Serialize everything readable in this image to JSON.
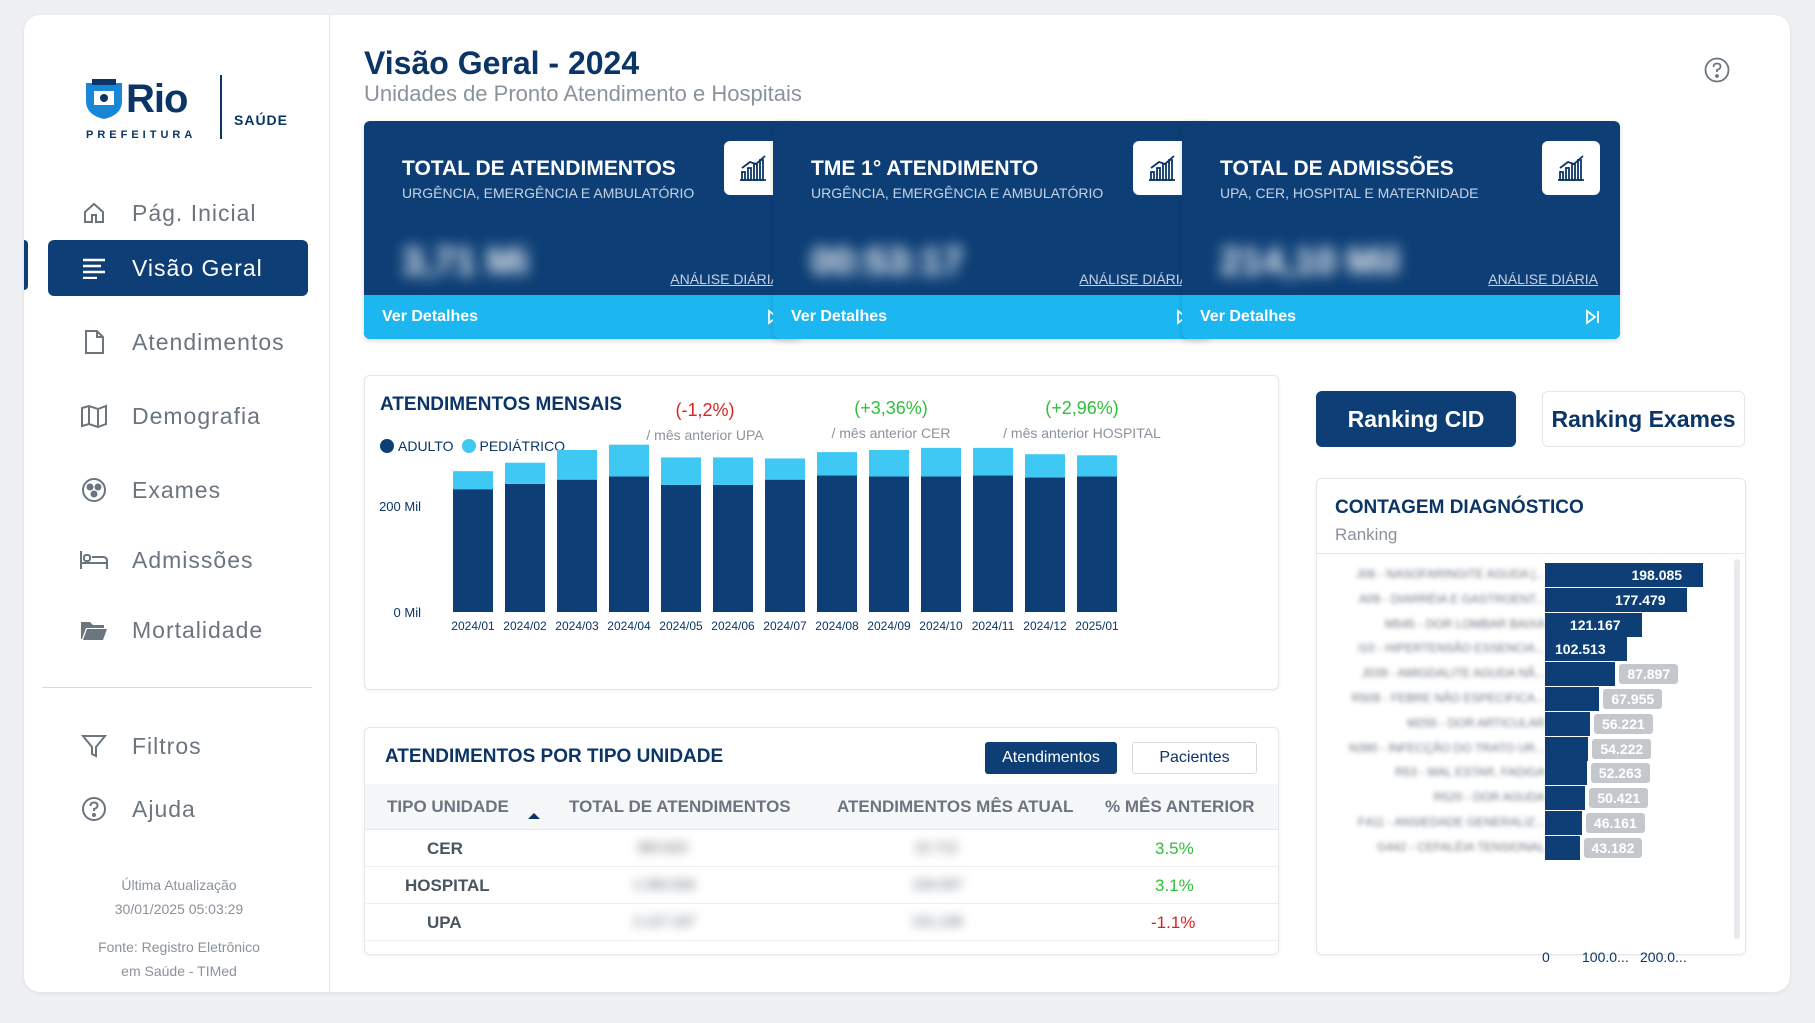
{
  "brand": {
    "name": "Rio",
    "sub": "PREFEITURA",
    "dept": "SAÚDE"
  },
  "sidebar": {
    "items": [
      {
        "label": "Pág. Inicial",
        "icon": "home-icon"
      },
      {
        "label": "Visão Geral",
        "icon": "list-icon"
      },
      {
        "label": "Atendimentos",
        "icon": "document-icon"
      },
      {
        "label": "Demografia",
        "icon": "map-icon"
      },
      {
        "label": "Exames",
        "icon": "dots-circle-icon"
      },
      {
        "label": "Admissões",
        "icon": "bed-icon"
      },
      {
        "label": "Mortalidade",
        "icon": "folder-icon"
      },
      {
        "label": "Filtros",
        "icon": "filter-icon"
      },
      {
        "label": "Ajuda",
        "icon": "help-icon"
      }
    ],
    "update_label": "Última Atualização",
    "update_time": "30/01/2025 05:03:29",
    "source_line1": "Fonte: Registro Eletrônico",
    "source_line2": "em Saúde - TIMed"
  },
  "header": {
    "title": "Visão Geral - 2024",
    "subtitle": "Unidades de Pronto Atendimento e Hospitais"
  },
  "kpis": [
    {
      "title": "TOTAL DE ATENDIMENTOS",
      "sub": "URGÊNCIA, EMERGÊNCIA E AMBULATÓRIO",
      "value": "3,71 Mi",
      "link": "ANÁLISE DIÁRIA",
      "footer": "Ver Detalhes"
    },
    {
      "title": "TME 1° ATENDIMENTO",
      "sub": "URGÊNCIA, EMERGÊNCIA E AMBULATÓRIO",
      "value": "00:53:17",
      "link": "ANÁLISE DIÁRIA",
      "footer": "Ver Detalhes"
    },
    {
      "title": "TOTAL DE ADMISSÕES",
      "sub": "UPA, CER, HOSPITAL E MATERNIDADE",
      "value": "214,10 Mil",
      "link": "ANÁLISE DIÁRIA",
      "footer": "Ver Detalhes"
    }
  ],
  "monthly": {
    "title": "ATENDIMENTOS MENSAIS",
    "legend": [
      "ADULTO",
      "PEDIÁTRICO"
    ],
    "comparisons": [
      {
        "pct": "(-1,2%)",
        "label": "/ mês anterior UPA",
        "color": "#e02020"
      },
      {
        "pct": "(+3,36%)",
        "label": "/ mês anterior CER",
        "color": "#2fbf3a"
      },
      {
        "pct": "(+2,96%)",
        "label": "/ mês anterior HOSPITAL",
        "color": "#2fbf3a"
      }
    ],
    "y_ticks": [
      "200 Mil",
      "0 Mil"
    ]
  },
  "chart_data": {
    "type": "bar",
    "stacked": true,
    "categories": [
      "2024/01",
      "2024/02",
      "2024/03",
      "2024/04",
      "2024/05",
      "2024/06",
      "2024/07",
      "2024/08",
      "2024/09",
      "2024/10",
      "2024/11",
      "2024/12",
      "2025/01"
    ],
    "series": [
      {
        "name": "ADULTO",
        "color": "#0d3f76",
        "values": [
          232,
          242,
          250,
          256,
          240,
          240,
          250,
          258,
          256,
          256,
          258,
          254,
          256
        ]
      },
      {
        "name": "PEDIÁTRICO",
        "color": "#3fc8f4",
        "values": [
          34,
          40,
          56,
          60,
          52,
          52,
          40,
          44,
          50,
          54,
          52,
          44,
          40
        ]
      }
    ],
    "ylabel": "",
    "ylim": [
      0,
      340
    ],
    "y_ticks": [
      0,
      200
    ]
  },
  "table": {
    "title": "ATENDIMENTOS POR TIPO UNIDADE",
    "toggles": [
      "Atendimentos",
      "Pacientes"
    ],
    "headers": [
      "TIPO UNIDADE",
      "TOTAL DE ATENDIMENTOS",
      "ATENDIMENTOS MÊS ATUAL",
      "% MÊS ANTERIOR"
    ],
    "rows": [
      {
        "tipo": "CER",
        "total": "383.620",
        "mes": "22.712",
        "pct": "3.5%",
        "pct_color": "#2fbf3a"
      },
      {
        "tipo": "HOSPITAL",
        "total": "1.283.934",
        "mes": "104.097",
        "pct": "3.1%",
        "pct_color": "#2fbf3a"
      },
      {
        "tipo": "UPA",
        "total": "2.127.197",
        "mes": "151.106",
        "pct": "-1.1%",
        "pct_color": "#e02020"
      }
    ]
  },
  "ranking": {
    "buttons": [
      "Ranking CID",
      "Ranking Exames"
    ],
    "title": "CONTAGEM DIAGNÓSTICO",
    "subtitle": "Ranking",
    "items": [
      {
        "label": "J06 - NASOFARINGITE AGUDA [...",
        "value": 198085,
        "display": "198.085"
      },
      {
        "label": "A09 - DIARRÉIA E GASTROENT...",
        "value": 177479,
        "display": "177.479"
      },
      {
        "label": "M545 - DOR LOMBAR BAIXA",
        "value": 121167,
        "display": "121.167"
      },
      {
        "label": "I10 - HIPERTENSÃO ESSENCIA...",
        "value": 102513,
        "display": "102.513"
      },
      {
        "label": "J039 - AMIGDALITE AGUDA NÃ...",
        "value": 87897,
        "display": "87.897"
      },
      {
        "label": "R509 - FEBRE NÃO ESPECIFICA...",
        "value": 67955,
        "display": "67.955"
      },
      {
        "label": "M255 - DOR ARTICULAR",
        "value": 56221,
        "display": "56.221"
      },
      {
        "label": "N390 - INFECÇÃO DO TRATO UR...",
        "value": 54222,
        "display": "54.222"
      },
      {
        "label": "R53 - MAL ESTAR, FADIGA",
        "value": 52263,
        "display": "52.263"
      },
      {
        "label": "R520 - DOR AGUDA",
        "value": 50421,
        "display": "50.421"
      },
      {
        "label": "F411 - ANSIEDADE GENERALIZ...",
        "value": 46161,
        "display": "46.161"
      },
      {
        "label": "G442 - CEFALÉIA TENSIONAL",
        "value": 43182,
        "display": "43.182"
      }
    ],
    "axis_ticks": [
      "0",
      "100.0...",
      "200.0..."
    ]
  }
}
